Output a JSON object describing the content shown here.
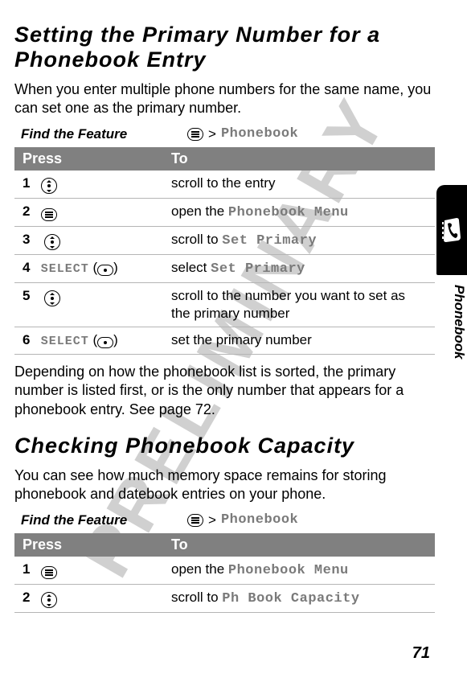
{
  "watermark": "PRELIMINARY",
  "side_tab_label": "Phonebook",
  "page_number": "71",
  "section1": {
    "title": "Setting the Primary Number for a Phonebook Entry",
    "intro": "When you enter multiple phone numbers for the same name, you can set one as the primary number.",
    "find_label": "Find the Feature",
    "find_gt": ">",
    "find_target": "Phonebook",
    "table": {
      "head_press": "Press",
      "head_to": "To",
      "rows": [
        {
          "num": "1",
          "to_pre": "scroll to the entry"
        },
        {
          "num": "2",
          "to_pre": "open the ",
          "mono": "Phonebook Menu"
        },
        {
          "num": "3",
          "to_pre": "scroll to ",
          "mono": "Set Primary"
        },
        {
          "num": "4",
          "soft": "SELECT",
          "paren_l": " (",
          "paren_r": ")",
          "to_pre": "select ",
          "mono": "Set Primary"
        },
        {
          "num": "5",
          "to_pre": "scroll to the number you want to set as the primary number"
        },
        {
          "num": "6",
          "soft": "SELECT",
          "paren_l": " (",
          "paren_r": ")",
          "to_pre": "set the primary number"
        }
      ]
    },
    "outro": "Depending on how the phonebook list is sorted, the primary number is listed first, or is the only number that appears for a phonebook entry. See page 72."
  },
  "section2": {
    "title": "Checking Phonebook Capacity",
    "intro": "You can see how much memory space remains for storing phonebook and datebook entries on your phone.",
    "find_label": "Find the Feature",
    "find_gt": ">",
    "find_target": "Phonebook",
    "table": {
      "head_press": "Press",
      "head_to": "To",
      "rows": [
        {
          "num": "1",
          "to_pre": "open the ",
          "mono": "Phonebook Menu"
        },
        {
          "num": "2",
          "to_pre": "scroll to ",
          "mono": "Ph Book Capacity"
        }
      ]
    }
  }
}
